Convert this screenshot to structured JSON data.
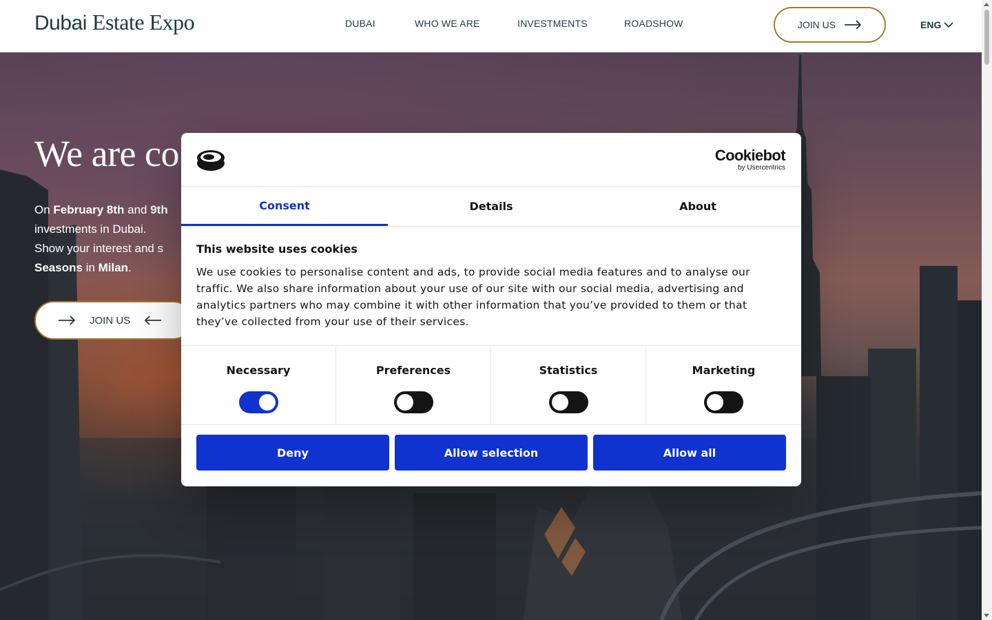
{
  "header": {
    "logo_part1": "Dubai",
    "logo_part2": "Estate Expo",
    "nav": [
      "DUBAI",
      "WHO WE ARE",
      "INVESTMENTS",
      "ROADSHOW"
    ],
    "join_label": "JOIN US",
    "language": "ENG"
  },
  "hero": {
    "title": "We are co",
    "line1_pre": "On ",
    "line1_bold1": "February 8th",
    "line1_mid": " and ",
    "line1_bold2": "9th",
    "line2": "investments in Dubai.",
    "line3": "Show your interest and s",
    "line4_bold1": "Seasons",
    "line4_mid": " in ",
    "line4_bold2": "Milan",
    "line4_end": ".",
    "join_label": "JOIN US"
  },
  "cookie_dialog": {
    "brand": "Cookiebot",
    "brand_sub": "by Usercentrics",
    "tabs": [
      "Consent",
      "Details",
      "About"
    ],
    "active_tab": "Consent",
    "heading": "This website uses cookies",
    "body": "We use cookies to personalise content and ads, to provide social media features and to analyse our traffic. We also share information about your use of our site with our social media, advertising and analytics partners who may combine it with other information that you’ve provided to them or that they’ve collected from your use of their services.",
    "toggles": [
      {
        "label": "Necessary",
        "on": true
      },
      {
        "label": "Preferences",
        "on": false
      },
      {
        "label": "Statistics",
        "on": false
      },
      {
        "label": "Marketing",
        "on": false
      }
    ],
    "buttons": {
      "deny": "Deny",
      "allow_selection": "Allow selection",
      "allow_all": "Allow all"
    }
  },
  "colors": {
    "brand_dark": "#1e3a3c",
    "gold": "#a37a2c",
    "cookiebot_blue": "#1032cf"
  }
}
